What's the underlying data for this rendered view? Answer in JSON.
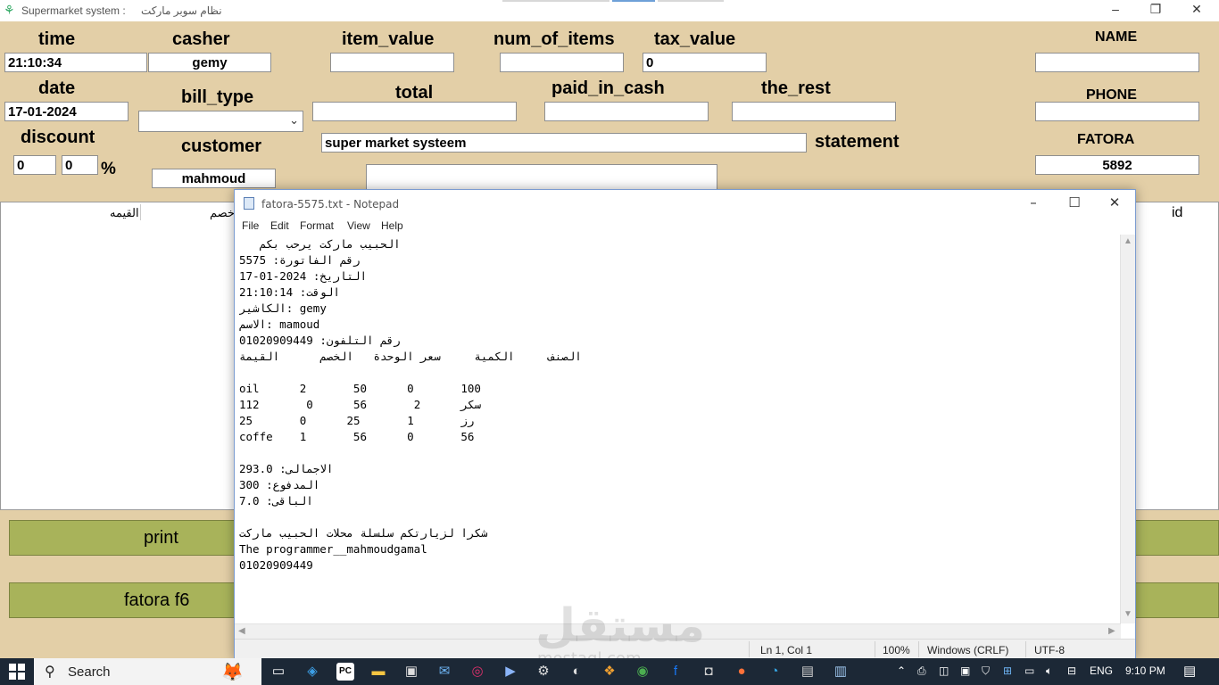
{
  "app": {
    "title": "Supermarket system :",
    "title_ar": "نظام سوبر ماركت",
    "min": "–",
    "restore": "❐",
    "close": "✕"
  },
  "form": {
    "time_label": "time",
    "time_value": "21:10:34",
    "casher_label": "casher",
    "casher_value": "gemy",
    "item_value_label": "item_value",
    "num_of_items_label": "num_of_items",
    "tax_value_label": "tax_value",
    "tax_value": "0",
    "name_label": "NAME",
    "date_label": "date",
    "date_value": "17-01-2024",
    "bill_type_label": "bill_type",
    "total_label": "total",
    "paid_in_cash_label": "paid_in_cash",
    "the_rest_label": "the_rest",
    "phone_label": "PHONE",
    "discount_label": "discount",
    "discount_value_1": "0",
    "discount_value_2": "0",
    "percent": "%",
    "customer_label": "customer",
    "customer_value": "mahmoud",
    "statement_value": "super market systeem",
    "statement_label": "statement",
    "fatora_label": "FATORA",
    "fatora_value": "5892"
  },
  "table": {
    "col_value": "القيمه",
    "col_discount": "خصم",
    "col_id": "id"
  },
  "buttons": {
    "print": "print",
    "fatora": "fatora  f6"
  },
  "notepad": {
    "title": "fatora-5575.txt - Notepad",
    "menu": [
      "File",
      "Edit",
      "Format",
      "View",
      "Help"
    ],
    "content": "   الحبيب ماركت يرحب بكم\nرقم الفاتورة: 5575\nالتاريخ: 2024-01-17\nالوقت: 21:10:14\nالكاشير: gemy\nالاسم: mamoud\nرقم التلفون: 01020909449\nالصنف     الكمية     سعر الوحدة   الخصم      القيمة\n\noil      2       50      0       100\nسكر      2       56      0       112\nرز       1       25      0       25\ncoffe    1       56      0       56\n\nالاجمالى: 293.0\nالمدفوع: 300\nالباقى: 7.0\n\nشكرا لزيارتكم سلسلة محلات الحبيب ماركت\nThe programmer__mahmoudgamal\n01020909449",
    "status_position": "Ln 1, Col 1",
    "status_zoom": "100%",
    "status_eol": "Windows (CRLF)",
    "status_encoding": "UTF-8"
  },
  "watermark": {
    "text": "مستقل",
    "sub": "mostaql.com"
  },
  "taskbar": {
    "search": "Search",
    "lang": "ENG",
    "time": "9:10 PM"
  }
}
